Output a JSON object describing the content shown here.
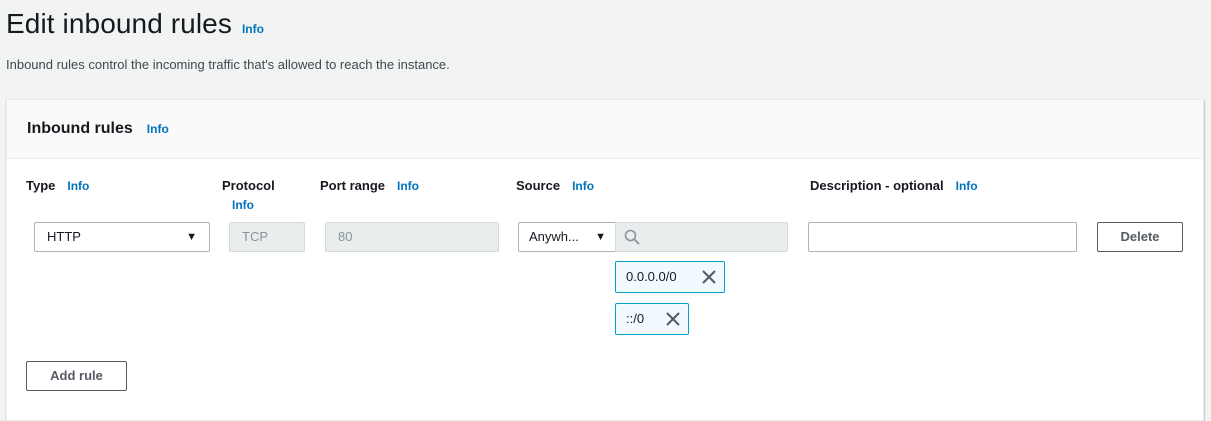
{
  "page": {
    "title": "Edit inbound rules",
    "title_info": "Info",
    "description": "Inbound rules control the incoming traffic that's allowed to reach the instance."
  },
  "panel": {
    "title": "Inbound rules",
    "title_info": "Info",
    "columns": {
      "type": {
        "label": "Type",
        "info": "Info"
      },
      "protocol": {
        "label": "Protocol",
        "info": "Info"
      },
      "port_range": {
        "label": "Port range",
        "info": "Info"
      },
      "source": {
        "label": "Source",
        "info": "Info"
      },
      "description": {
        "label": "Description - optional",
        "info": "Info"
      }
    },
    "rule": {
      "type": "HTTP",
      "protocol": "TCP",
      "port_range": "80",
      "source_select": "Anywh...",
      "source_search_value": "",
      "source_tokens": [
        "0.0.0.0/0",
        "::/0"
      ],
      "description_value": "",
      "delete_label": "Delete"
    },
    "add_rule_label": "Add rule"
  },
  "colors": {
    "link": "#0073bb",
    "token_border": "#00a1c9",
    "token_bg": "#f1faff",
    "disabled_bg": "#eaeded"
  },
  "icons": {
    "select_caret": "caret-down-icon",
    "search": "search-icon",
    "token_remove": "close-icon"
  }
}
